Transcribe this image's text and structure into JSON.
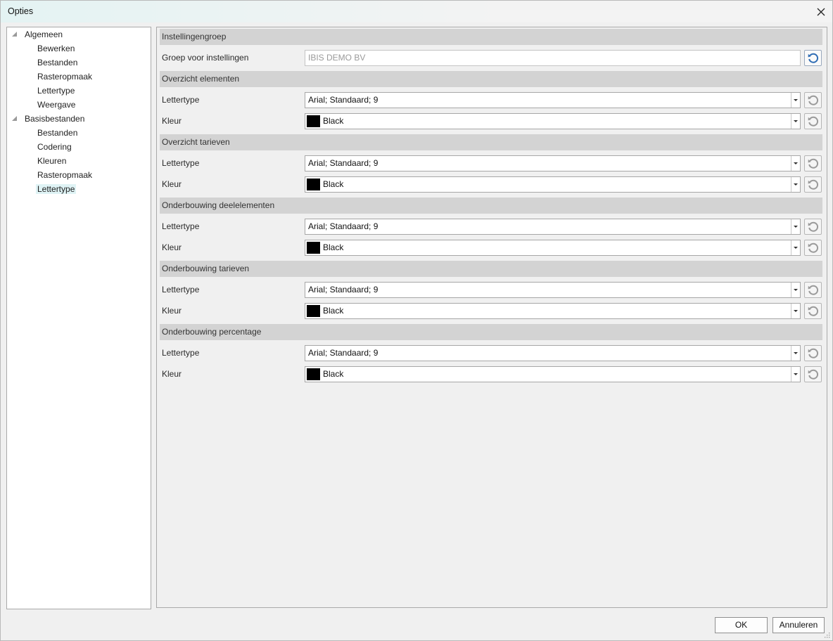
{
  "window": {
    "title": "Opties"
  },
  "tree": {
    "groups": [
      {
        "label": "Algemeen",
        "children": [
          "Bewerken",
          "Bestanden",
          "Rasteropmaak",
          "Lettertype",
          "Weergave"
        ]
      },
      {
        "label": "Basisbestanden",
        "children": [
          "Bestanden",
          "Codering",
          "Kleuren",
          "Rasteropmaak",
          "Lettertype"
        ]
      }
    ],
    "selected": "Basisbestanden/Lettertype"
  },
  "panel": {
    "settings_group": {
      "header": "Instellingengroep",
      "label": "Groep voor instellingen",
      "value": "IBIS DEMO BV"
    },
    "sections": [
      {
        "header": "Overzicht elementen",
        "font_label": "Lettertype",
        "font_value": "Arial; Standaard; 9",
        "color_label": "Kleur",
        "color_value": "Black",
        "color_swatch": "#000000"
      },
      {
        "header": "Overzicht tarieven",
        "font_label": "Lettertype",
        "font_value": "Arial; Standaard; 9",
        "color_label": "Kleur",
        "color_value": "Black",
        "color_swatch": "#000000"
      },
      {
        "header": "Onderbouwing deelelementen",
        "font_label": "Lettertype",
        "font_value": "Arial; Standaard; 9",
        "color_label": "Kleur",
        "color_value": "Black",
        "color_swatch": "#000000"
      },
      {
        "header": "Onderbouwing tarieven",
        "font_label": "Lettertype",
        "font_value": "Arial; Standaard; 9",
        "color_label": "Kleur",
        "color_value": "Black",
        "color_swatch": "#000000"
      },
      {
        "header": "Onderbouwing percentage",
        "font_label": "Lettertype",
        "font_value": "Arial; Standaard; 9",
        "color_label": "Kleur",
        "color_value": "Black",
        "color_swatch": "#000000"
      }
    ]
  },
  "footer": {
    "ok_label": "OK",
    "cancel_label": "Annuleren"
  },
  "colors": {
    "reset_active": "#2f6db5",
    "reset_inactive": "#9a9a9a",
    "selection": "#dff3f5",
    "section_header": "#d3d3d3"
  },
  "icons": {
    "close": "close-icon",
    "reset": "reset-icon",
    "expander": "tree-expander-icon",
    "dropdown": "chevron-down-icon"
  }
}
